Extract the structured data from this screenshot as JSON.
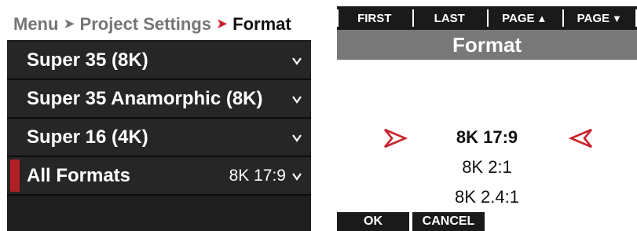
{
  "breadcrumb": {
    "menu": "Menu",
    "section": "Project Settings",
    "current": "Format",
    "separator": "➤"
  },
  "menu_items": [
    {
      "label": "Super 35 (8K)",
      "value": "",
      "selected": false
    },
    {
      "label": "Super 35 Anamorphic (8K)",
      "value": "",
      "selected": false
    },
    {
      "label": "Super 16 (4K)",
      "value": "",
      "selected": false
    },
    {
      "label": "All Formats",
      "value": "8K 17:9",
      "selected": true
    }
  ],
  "softkeys": {
    "first": "FIRST",
    "last": "LAST",
    "page_up": "PAGE",
    "page_down": "PAGE",
    "up_glyph": "▲",
    "down_glyph": "▼"
  },
  "dialog": {
    "title": "Format",
    "options": [
      "8K 17:9",
      "8K 2:1",
      "8K 2.4:1"
    ],
    "selected_option": "8K 17:9"
  },
  "bottom_keys": {
    "ok": "OK",
    "cancel": "CANCEL"
  },
  "colors": {
    "accent_red": "#c8232c",
    "selection_bar": "#b21f24",
    "title_grey": "#787878"
  },
  "icons": {
    "menu_chevron": "chevron-down-icon",
    "selector_left": "red-arrow-right-icon",
    "selector_right": "red-arrow-left-icon"
  }
}
